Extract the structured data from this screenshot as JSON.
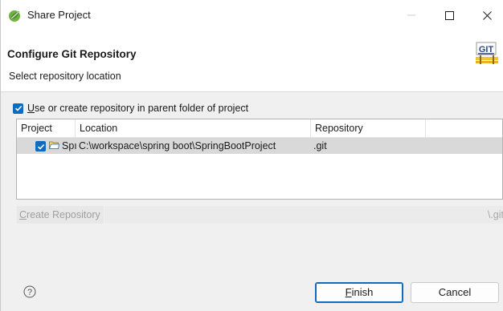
{
  "window": {
    "title": "Share Project",
    "app_icon": "eclipse-spring-icon",
    "minimize_icon": "minimize-icon",
    "maximize_icon": "maximize-icon",
    "close_icon": "close-icon"
  },
  "header": {
    "title": "Configure Git Repository",
    "description": "Select repository location",
    "logo_text": "GIT"
  },
  "use_parent": {
    "checked": true,
    "mnemonic": "U",
    "label_rest": "se or create repository in parent folder of project"
  },
  "table": {
    "columns": [
      "Project",
      "Location",
      "Repository",
      ""
    ],
    "rows": [
      {
        "checked": true,
        "project": "SpringBootProject",
        "project_visible": "Spı",
        "location": "C:\\workspace\\spring boot\\SpringBootProject",
        "repository": ".git"
      }
    ]
  },
  "create_repository": {
    "mnemonic": "C",
    "label_rest": "reate Repository",
    "path_suffix": "\\.git"
  },
  "footer": {
    "help_icon": "help-icon",
    "finish_mnemonic": "F",
    "finish_rest": "inish",
    "cancel_label": "Cancel"
  },
  "colors": {
    "accent": "#0f6cbd",
    "selected_row": "#d9d9d9",
    "disabled_text": "#a0a0a0"
  }
}
